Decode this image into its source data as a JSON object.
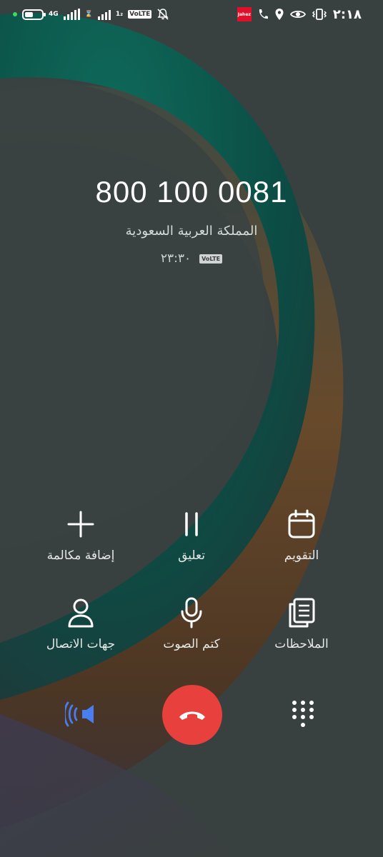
{
  "status_bar": {
    "network_type": "4G",
    "sim2_label": "1₂",
    "volte": "VoLTE",
    "jahez_label": "Jahez",
    "time": "٢:١٨"
  },
  "call": {
    "number": "800 100 0081",
    "location": "المملكة العربية السعودية",
    "duration": "٢٣:٣٠",
    "hd_badge": "VoLTE"
  },
  "actions": {
    "add_call": "إضافة مكالمة",
    "hold": "تعليق",
    "calendar": "التقويم",
    "contacts": "جهات الاتصال",
    "mute": "كتم الصوت",
    "notes": "الملاحظات"
  },
  "colors": {
    "end_call": "#e8403c",
    "speaker_active": "#4a7df0",
    "wallpaper_teal": "#0d5a4e",
    "wallpaper_brown": "#5b3f24"
  },
  "icons": {
    "speaker": "speaker-icon",
    "end_call": "phone-hangup-icon",
    "keypad": "dialpad-icon"
  }
}
